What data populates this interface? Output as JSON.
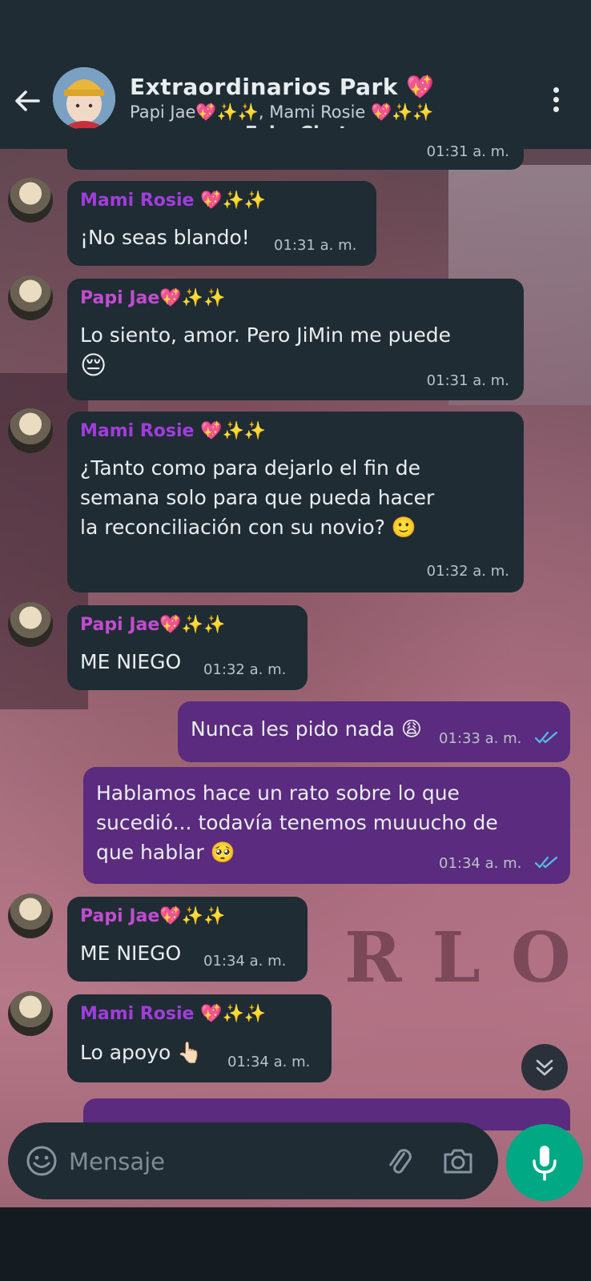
{
  "header": {
    "title": "Extraordinarios Park 💖",
    "subtitle": "Papi Jae💖✨✨, Mami Rosie 💖✨✨",
    "watermark": "Fake Chat"
  },
  "messages": [
    {
      "id": "m0",
      "time": "01:31 a. m."
    },
    {
      "id": "m1",
      "sender": "Mami Rosie 💖✨✨",
      "text": "¡No seas blando!",
      "time": "01:31 a. m."
    },
    {
      "id": "m2",
      "sender": "Papi Jae💖✨✨",
      "text_line1": "Lo siento, amor. Pero JiMin me puede",
      "text_line2": "😔",
      "time": "01:31 a. m."
    },
    {
      "id": "m3",
      "sender": "Mami Rosie 💖✨✨",
      "text_line1": "¿Tanto como para dejarlo el fin de",
      "text_line2": "semana solo para que pueda hacer",
      "text_line3": "la reconciliación con su novio? 🙂",
      "time": "01:32 a. m."
    },
    {
      "id": "m4",
      "sender": "Papi Jae💖✨✨",
      "text": "ME NIEGO",
      "time": "01:32 a. m."
    },
    {
      "id": "m5",
      "text": "Nunca les pido nada 😩",
      "time": "01:33 a. m."
    },
    {
      "id": "m6",
      "text_line1": "Hablamos hace un rato sobre lo que",
      "text_line2": "sucedió... todavía tenemos muuucho de",
      "text_line3": "que hablar 🥺",
      "time": "01:34 a. m."
    },
    {
      "id": "m7",
      "sender": "Papi Jae💖✨✨",
      "text": "ME NIEGO",
      "time": "01:34 a. m."
    },
    {
      "id": "m8",
      "sender": "Mami Rosie 💖✨✨",
      "text": "Lo apoyo 👆🏻",
      "time": "01:34 a. m."
    }
  ],
  "composer": {
    "placeholder": "Mensaje"
  },
  "icons": {
    "back": "back-arrow-icon",
    "menu": "more-vert-icon",
    "emoji": "emoji-icon",
    "attach": "paperclip-icon",
    "camera": "camera-icon",
    "mic": "microphone-icon",
    "scroll": "double-chevron-down-icon",
    "read": "double-check-icon"
  },
  "colors": {
    "header_bg": "#1f2c34",
    "bubble_in": "#1f2c34",
    "bubble_out": "#5a2b7e",
    "accent": "#00a884",
    "read_tick": "#53bdeb"
  }
}
